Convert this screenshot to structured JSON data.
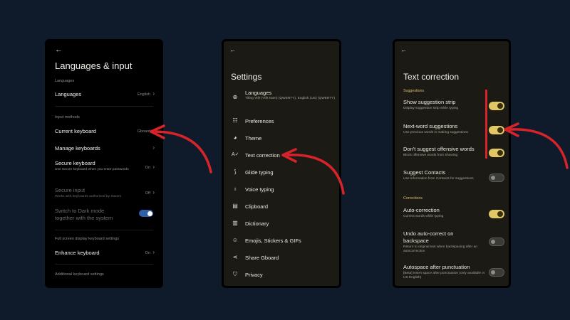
{
  "screen1": {
    "back": "←",
    "title": "Languages & input",
    "languages_section": "Languages",
    "languages_label": "Languages",
    "languages_value": "English",
    "input_methods_section": "Input methods",
    "current_keyboard_label": "Current keyboard",
    "current_keyboard_value": "Gboard",
    "manage_keyboards_label": "Manage keyboards",
    "secure_keyboard_label": "Secure keyboard",
    "secure_keyboard_sub": "Use secure keyboard when you enter passwords",
    "secure_keyboard_value": "On",
    "secure_input_label": "Secure input",
    "secure_input_sub": "Works with keyboards authorized by Xiaomi",
    "secure_input_value": "Off",
    "dark_mode_label": "Switch to Dark mode together with the system",
    "dark_mode_toggle": "on",
    "fullscreen_section": "Full screen display keyboard settings",
    "enhance_keyboard_label": "Enhance keyboard",
    "enhance_keyboard_value": "On",
    "additional_settings": "Additional keyboard settings"
  },
  "screen2": {
    "back": "←",
    "title": "Settings",
    "items": [
      {
        "icon": "globe-icon",
        "label": "Languages",
        "sub": "Tiếng Việt (Việt Nam) (QWERTY), English (US) (QWERTY)"
      },
      {
        "icon": "sliders-icon",
        "label": "Preferences"
      },
      {
        "icon": "palette-icon",
        "label": "Theme"
      },
      {
        "icon": "text-correction-icon",
        "label": "Text correction"
      },
      {
        "icon": "glide-icon",
        "label": "Glide typing"
      },
      {
        "icon": "mic-icon",
        "label": "Voice typing"
      },
      {
        "icon": "clipboard-icon",
        "label": "Clipboard"
      },
      {
        "icon": "book-icon",
        "label": "Dictionary"
      },
      {
        "icon": "emoji-icon",
        "label": "Emojis, Stickers & GIFs"
      },
      {
        "icon": "share-icon",
        "label": "Share Gboard"
      },
      {
        "icon": "shield-icon",
        "label": "Privacy"
      }
    ]
  },
  "screen3": {
    "back": "←",
    "title": "Text correction",
    "suggestions_section": "Suggestions",
    "show_strip_label": "Show suggestion strip",
    "show_strip_sub": "Display suggestion strip while typing",
    "next_word_label": "Next-word suggestions",
    "next_word_sub": "Use previous words in making suggestions",
    "offensive_label": "Don't suggest offensive words",
    "offensive_sub": "Block offensive words from showing",
    "contacts_label": "Suggest Contacts",
    "contacts_sub": "Use information from Contacts for suggestions",
    "corrections_section": "Corrections",
    "autocorrect_label": "Auto-correction",
    "autocorrect_sub": "Correct words while typing",
    "undo_label": "Undo auto-correct on backspace",
    "undo_sub": "Return to original text when backspacing after an autocorrection",
    "autospace_label": "Autospace after punctuation",
    "autospace_sub": "[Beta] Insert space after punctuation (only available in US English)"
  },
  "colors": {
    "background": "#0f1b2b",
    "accent_yellow": "#e2c765",
    "toggle_blue": "#2f5fa8",
    "annotation_red": "#d8232a"
  }
}
